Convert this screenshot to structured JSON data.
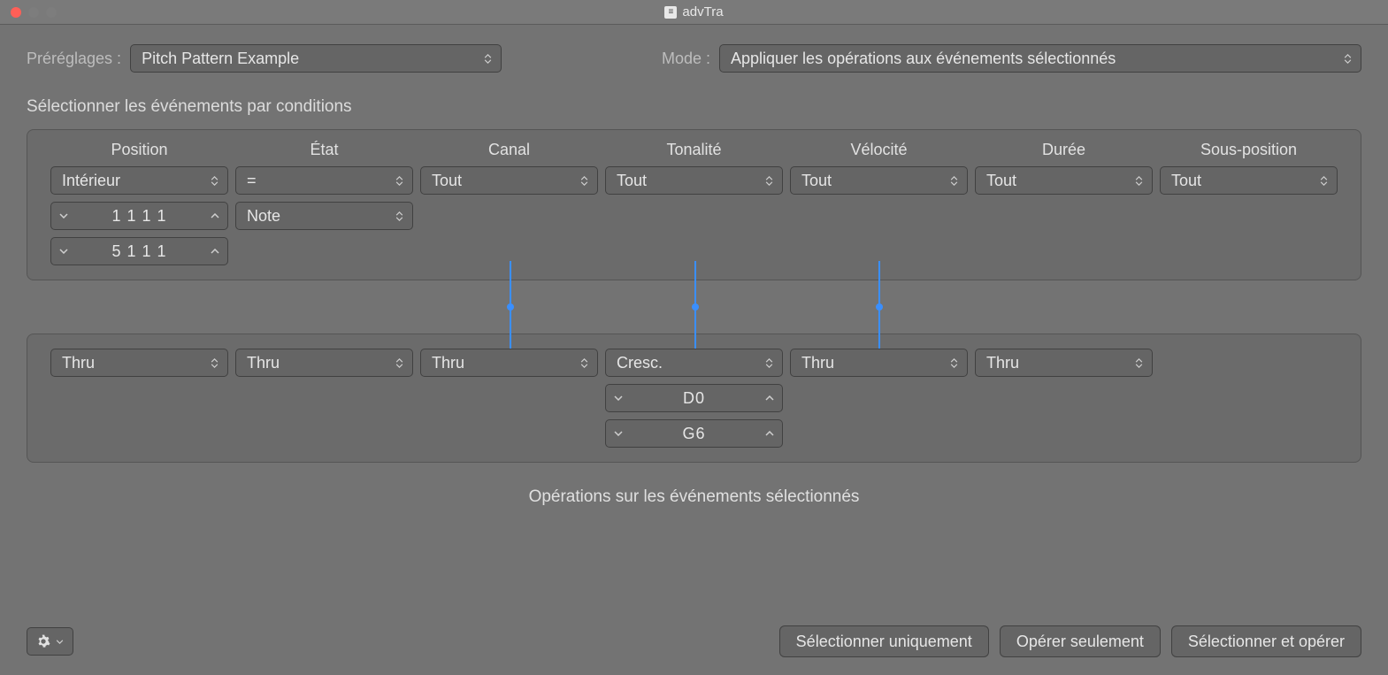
{
  "window": {
    "title": "advTra"
  },
  "top": {
    "presets_label": "Préréglages :",
    "preset_value": "Pitch Pattern Example",
    "mode_label": "Mode :",
    "mode_value": "Appliquer les opérations aux événements sélectionnés"
  },
  "conditions": {
    "title": "Sélectionner les événements par conditions",
    "headers": [
      "Position",
      "État",
      "Canal",
      "Tonalité",
      "Vélocité",
      "Durée",
      "Sous-position"
    ],
    "row1": {
      "position": "Intérieur",
      "etat": "=",
      "canal": "Tout",
      "tonalite": "Tout",
      "velocite": "Tout",
      "duree": "Tout",
      "souspos": "Tout"
    },
    "row2": {
      "pos_from": "1 1 1   1",
      "etat_type": "Note"
    },
    "row3": {
      "pos_to": "5 1 1   1"
    }
  },
  "operations": {
    "row": {
      "c1": "Thru",
      "c2": "Thru",
      "c3": "Thru",
      "c4": "Cresc.",
      "c5": "Thru",
      "c6": "Thru"
    },
    "tonalite_from": "D0",
    "tonalite_to": "G6",
    "caption": "Opérations sur les événements sélectionnés"
  },
  "buttons": {
    "select_only": "Sélectionner uniquement",
    "operate_only": "Opérer seulement",
    "select_and_operate": "Sélectionner et opérer"
  }
}
